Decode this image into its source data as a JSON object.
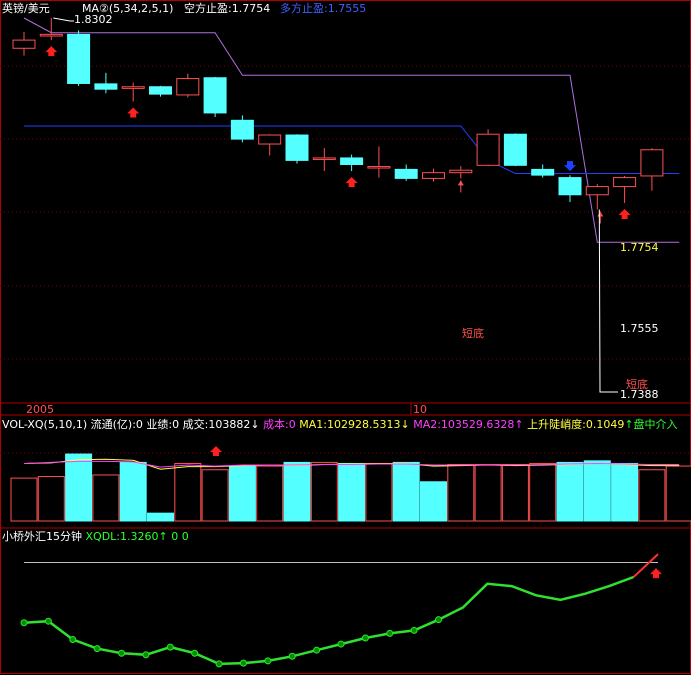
{
  "header": {
    "symbol": "英镑/美元",
    "ma_label": "MA②(5,34,2,5,1)",
    "short_stop_label": "空方止盈:1.7754",
    "long_stop_label": "多方止盈:1.7555",
    "price_high": "1.8302",
    "price_low": "1.7388",
    "stop_short_value": "1.7754",
    "stop_long_value": "1.7555",
    "year_label": "2005",
    "month_label": "10"
  },
  "volume_header": {
    "name": "VOL-XQ(5,10,1)",
    "float": "流通(亿):0",
    "perf": "业绩:0",
    "deal": "成交:103882",
    "deal_arrow": "↓",
    "cost": "成本:0",
    "ma1": "MA1:102928.5313",
    "ma1_arrow": "↓",
    "ma2": "MA2:103529.6328",
    "ma2_arrow": "↑",
    "steep": "上升陡峭度:0.1049",
    "steep_arrow": "↑",
    "tail": "盘中介入"
  },
  "indicator_header": {
    "title": "小桥外汇15分钟",
    "xqdl": "XQDL:1.3260",
    "xqdl_arrow": "↑",
    "extra": "0 0"
  },
  "annotations": {
    "short_bottom": "短底"
  },
  "colors": {
    "up": "#ff5050",
    "down": "#54ffff",
    "grid": "#7f0000",
    "frame": "#b00000",
    "short_stop_line": "#b070e0",
    "long_stop_line": "#2040ff",
    "indicator_line": "#30e030",
    "indicator_dot": "#009000",
    "indicator_last": "#ff3030",
    "header_text": "#ffffff",
    "yellow": "#ffff40",
    "magenta": "#ff40ff",
    "green": "#30ff30",
    "blue_label": "#4060ff",
    "red_arrow": "#ff2020",
    "blue_arrow": "#2040ff"
  },
  "chart_data": [
    {
      "type": "candlestick",
      "title": "英镑/美元",
      "y_range": [
        1.7388,
        1.8302
      ],
      "candles": [
        {
          "o": 1.8228,
          "h": 1.8268,
          "l": 1.821,
          "c": 1.8248
        },
        {
          "o": 1.8258,
          "h": 1.8302,
          "l": 1.8248,
          "c": 1.8262
        },
        {
          "o": 1.8262,
          "h": 1.8272,
          "l": 1.8136,
          "c": 1.8142
        },
        {
          "o": 1.8141,
          "h": 1.8168,
          "l": 1.8118,
          "c": 1.8128
        },
        {
          "o": 1.813,
          "h": 1.8144,
          "l": 1.8098,
          "c": 1.8134
        },
        {
          "o": 1.8134,
          "h": 1.8136,
          "l": 1.811,
          "c": 1.8116
        },
        {
          "o": 1.8114,
          "h": 1.8166,
          "l": 1.8108,
          "c": 1.8154
        },
        {
          "o": 1.8156,
          "h": 1.8158,
          "l": 1.806,
          "c": 1.807
        },
        {
          "o": 1.8052,
          "h": 1.8064,
          "l": 1.7998,
          "c": 1.8006
        },
        {
          "o": 1.7994,
          "h": 1.8018,
          "l": 1.7966,
          "c": 1.8016
        },
        {
          "o": 1.8016,
          "h": 1.8018,
          "l": 1.7946,
          "c": 1.7954
        },
        {
          "o": 1.7958,
          "h": 1.7984,
          "l": 1.7928,
          "c": 1.796
        },
        {
          "o": 1.796,
          "h": 1.7968,
          "l": 1.7928,
          "c": 1.7944
        },
        {
          "o": 1.7936,
          "h": 1.7988,
          "l": 1.7912,
          "c": 1.7939
        },
        {
          "o": 1.7932,
          "h": 1.7944,
          "l": 1.7904,
          "c": 1.791
        },
        {
          "o": 1.791,
          "h": 1.7934,
          "l": 1.7902,
          "c": 1.7924
        },
        {
          "o": 1.7924,
          "h": 1.794,
          "l": 1.791,
          "c": 1.793
        },
        {
          "o": 1.7942,
          "h": 1.803,
          "l": 1.794,
          "c": 1.8018
        },
        {
          "o": 1.8018,
          "h": 1.802,
          "l": 1.794,
          "c": 1.7942
        },
        {
          "o": 1.7932,
          "h": 1.7944,
          "l": 1.7912,
          "c": 1.7918
        },
        {
          "o": 1.7912,
          "h": 1.7918,
          "l": 1.7852,
          "c": 1.787
        },
        {
          "o": 1.787,
          "h": 1.7896,
          "l": 1.7834,
          "c": 1.789
        },
        {
          "o": 1.789,
          "h": 1.7916,
          "l": 1.785,
          "c": 1.7912
        },
        {
          "o": 1.7916,
          "h": 1.7984,
          "l": 1.788,
          "c": 1.798
        }
      ],
      "short_stop": [
        1.8302,
        1.8266,
        1.8266,
        1.8266,
        1.8266,
        1.8266,
        1.8266,
        1.8266,
        1.8162,
        1.8162,
        1.8162,
        1.8162,
        1.8162,
        1.8162,
        1.8162,
        1.8162,
        1.8162,
        1.8162,
        1.8162,
        1.8162,
        1.8162,
        1.7754,
        1.7754,
        1.7754,
        1.7754
      ],
      "long_stop": [
        1.8038,
        1.8038,
        1.8038,
        1.8038,
        1.8038,
        1.8038,
        1.8038,
        1.8038,
        1.8038,
        1.8038,
        1.8038,
        1.8038,
        1.8038,
        1.8038,
        1.8038,
        1.8038,
        1.8038,
        1.7954,
        1.7922,
        1.7922,
        1.7922,
        1.7922,
        1.7922,
        1.7922,
        1.7922
      ],
      "up_arrows": [
        1,
        4,
        12,
        22
      ],
      "down_arrows": [
        20
      ],
      "short_bottom_at": [
        16,
        21
      ]
    },
    {
      "type": "bar",
      "title": "VOL-XQ(5,10,1)",
      "y_range": [
        0,
        130000
      ],
      "values": [
        82000,
        85000,
        128000,
        88000,
        112000,
        15000,
        110000,
        98000,
        105000,
        105000,
        112000,
        112000,
        110000,
        110000,
        112000,
        75000,
        108000,
        108000,
        108000,
        110000,
        112000,
        115000,
        110000,
        98000,
        105000
      ],
      "up": [
        true,
        true,
        false,
        true,
        false,
        false,
        true,
        true,
        false,
        true,
        false,
        true,
        false,
        true,
        false,
        false,
        true,
        true,
        true,
        true,
        false,
        false,
        false,
        true,
        true
      ],
      "ma1": [
        110000,
        111000,
        117000,
        118000,
        116000,
        99000,
        104000,
        104000,
        106000,
        107000,
        106000,
        108000,
        109000,
        110000,
        110000,
        105000,
        106000,
        107000,
        106000,
        107000,
        108000,
        110000,
        108000,
        106000,
        106000
      ],
      "ma2": [
        110000,
        112000,
        114000,
        114000,
        113000,
        103000,
        107000,
        105000,
        107000,
        107000,
        107000,
        108000,
        108000,
        109000,
        109000,
        107000,
        107000,
        107000,
        107000,
        108000,
        109000,
        110000,
        109000,
        108000,
        108000
      ]
    },
    {
      "type": "line",
      "title": "小桥外汇15分钟",
      "y_range": [
        0,
        1.6
      ],
      "reference": 1.41,
      "values": [
        0.62,
        0.64,
        0.4,
        0.28,
        0.22,
        0.2,
        0.3,
        0.22,
        0.08,
        0.09,
        0.12,
        0.18,
        0.26,
        0.34,
        0.42,
        0.48,
        0.52,
        0.66,
        0.82,
        1.13,
        1.1,
        0.98,
        0.92,
        1.0,
        1.1,
        1.22,
        1.52
      ]
    }
  ]
}
